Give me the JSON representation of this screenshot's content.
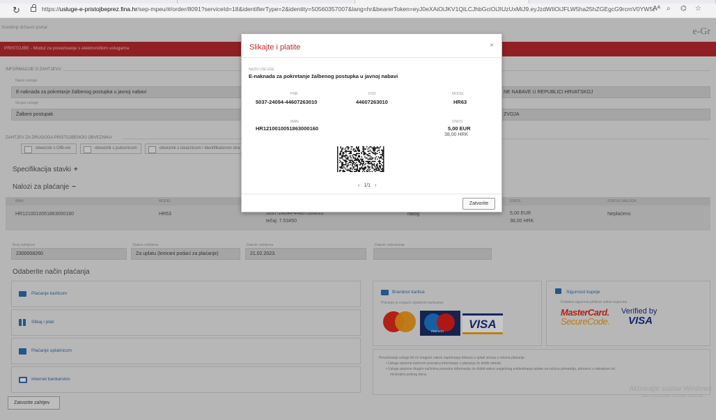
{
  "browser": {
    "url_prefix": "https://",
    "url_host": "usluge-e-pristojbeprez.fina.hr",
    "url_rest": "/sep-mpeu/#/order/8091?serviceId=18&identifierType=2&identity=50560357007&lang=hr&bearerToken=eyJ0eXAiOiJKV1QiLCJhbGciOiJIUzUxMiJ9.eyJzdWIiOiJFLW5ha25hZGEgcG9rcmV0YW5q...",
    "reader_label": "Aᴬ"
  },
  "portal": {
    "title": "Središnji državni portal",
    "logo": "e-Gr",
    "module_title": "PRISTOJBE - Modul za povezivanje s elektroničkim uslugama"
  },
  "request": {
    "section_label": "INFORMACIJE O ZAHTJEVU",
    "service_label": "Naziv usluge",
    "service_value": "E-naknada za pokretanje žalbenog postupka u javnoj nabavi",
    "group_label": "Grupa usluge",
    "group_value": "Žalbeni postupak",
    "right_value_1": "NE NABAVE U REPUBLICI HRVATSKOJ",
    "right_value_2": "ZVOJA"
  },
  "other_payer": {
    "section_label": "ZAHTJEV ZA DRUGOGA PRISTOJBENOG OBVEZNIKA",
    "options": [
      "obveznik s OIB-om",
      "obveznik s putovnicom",
      "obveznik s iskaznicom / identifikatorom stra"
    ]
  },
  "headings": {
    "items": "Specifikacija stavki",
    "items_symbol": "+",
    "orders": "Nalozi za plaćanje",
    "orders_symbol": "−",
    "payment_method": "Odaberite način plaćanja"
  },
  "orders_table": {
    "headers": [
      "IBAN",
      "MODEL",
      "IZNOS",
      "STATUS NALOGA"
    ],
    "row": {
      "iban": "HR1210010051863000160",
      "model": "HR63",
      "pnb": "5037-24094-44607263010",
      "rate": "tečaj: 7.53450",
      "type": "nalog",
      "amount_eur": "5,00 EUR",
      "amount_hrk": "38,00 HRK",
      "status": "Neplaćeno"
    }
  },
  "request_meta": {
    "number_label": "Broj zahtjeva",
    "number_value": "2300008260",
    "status_label": "Status zahtjeva",
    "status_value": "Za uplatu (kreirani podaci za plaćanje)",
    "created_label": "Datum zahtjeva",
    "created_value": "21.02.2023.",
    "closed_label": "Datum zatvaranja",
    "closed_value": ""
  },
  "payment_options": [
    "Plaćanje karticom",
    "Slikaj i plati",
    "Plaćanje uplatnicom",
    "Internet bankarstvo"
  ],
  "cards_box": {
    "title": "Brandovi kartica",
    "subtitle": "Plaćanje je moguće sljedećim karticama:",
    "visa": "VISA",
    "maestro": "maestro"
  },
  "secure_box": {
    "title": "Sigurnost kupnje",
    "subtitle": "Dodatna sigurnost prilikom online kupovine",
    "mastercard_1": "MasterCard.",
    "mastercard_2": "SecureCode.",
    "verified_1": "Verified by",
    "verified_2": "VISA"
  },
  "info_box": {
    "lines": [
      "Preuzimanje usluge bit će moguće nakon zaprimanja dokaza o uplati iznosa s računa plaćanje.",
      "• Usluge plaćene karticom povratnu informaciju o plaćanju će dobiti odmah.",
      "• Usluge plaćene drugim načinima povratnu informaciju će dobiti nakon uspješnog evidentiranja uplate na računu primatelja, odnosno s odmakom od",
      "minimalno jednog dana."
    ]
  },
  "close_request": "Zatvorite zahtjev",
  "windows_watermark": {
    "line1": "Aktivirajte sustav Windows",
    "line2": "Idite u postavke da biste aktivirali..."
  },
  "modal": {
    "title": "Slikajte i platite",
    "close": "×",
    "service_label": "NAZIV USLUGE",
    "service_value": "E-naknada za pokretanje žalbenog postupka u javnoj nabavi",
    "pnb_label": "PNB",
    "pnb_value": "5037-24094-44607263010",
    "code_label": "KOD",
    "code_value": "44607263010",
    "model_label": "MODEL",
    "model_value": "HR63",
    "iban_label": "IBAN",
    "iban_value": "HR1210010051863000160",
    "amount_label": "IZNOS",
    "amount_eur": "5,00 EUR",
    "amount_hrk": "38,00 HRK",
    "pager_prev": "‹",
    "pager_text": "1/1",
    "pager_next": "›",
    "button": "Zatvorite"
  }
}
